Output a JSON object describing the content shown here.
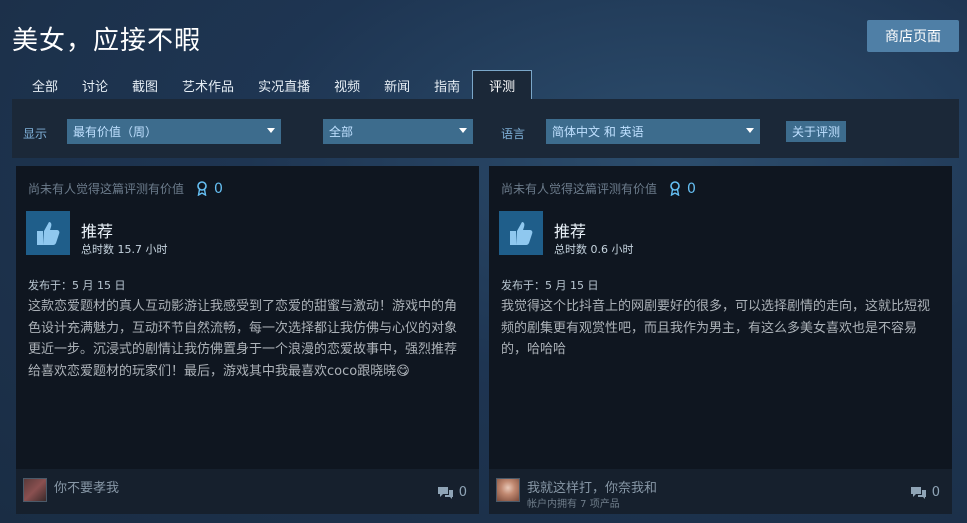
{
  "header": {
    "title": "美女，应接不暇",
    "store_button": "商店页面"
  },
  "tabs": [
    {
      "label": "全部"
    },
    {
      "label": "讨论"
    },
    {
      "label": "截图"
    },
    {
      "label": "艺术作品"
    },
    {
      "label": "实况直播"
    },
    {
      "label": "视频"
    },
    {
      "label": "新闻"
    },
    {
      "label": "指南"
    },
    {
      "label": "评测",
      "active": true
    }
  ],
  "filters": {
    "show_label": "显示",
    "sort_value": "最有价值（周）",
    "type_value": "全部",
    "lang_label": "语言",
    "lang_value": "简体中文 和 英语",
    "about_button": "关于评测"
  },
  "reviews": [
    {
      "helpful_text": "尚未有人觉得这篇评测有价值",
      "award_count": "0",
      "recommendation": "推荐",
      "hours": "总时数 15.7 小时",
      "posted": "发布于：5 月 15 日",
      "text": "这款恋爱题材的真人互动影游让我感受到了恋爱的甜蜜与激动！游戏中的角色设计充满魅力，互动环节自然流畅，每一次选择都让我仿佛与心仪的对象更近一步。沉浸式的剧情让我仿佛置身于一个浪漫的恋爱故事中，强烈推荐给喜欢恋爱题材的玩家们！最后，游戏其中我最喜欢coco跟晓晓😋",
      "author": "你不要孝我",
      "author_owned": "",
      "comment_count": "0"
    },
    {
      "helpful_text": "尚未有人觉得这篇评测有价值",
      "award_count": "0",
      "recommendation": "推荐",
      "hours": "总时数 0.6 小时",
      "posted": "发布于：5 月 15 日",
      "text": "我觉得这个比抖音上的网剧要好的很多，可以选择剧情的走向，这就比短视频的剧集更有观赏性吧，而且我作为男主，有这么多美女喜欢也是不容易的，哈哈哈",
      "author": "我就这样打，你奈我和",
      "author_owned": "帐户内拥有 7 项产品",
      "comment_count": "0"
    }
  ],
  "colors": {
    "accent": "#66c0f4",
    "tab_active_border": "#7ba7c9",
    "thumb_bg": "#1f5e8a",
    "select_bg": "#3d6c8d"
  },
  "icons": {
    "award": "award-ribbon-icon",
    "thumb": "thumbs-up-icon",
    "comment": "comment-bubble-icon",
    "caret": "caret-down-icon"
  }
}
